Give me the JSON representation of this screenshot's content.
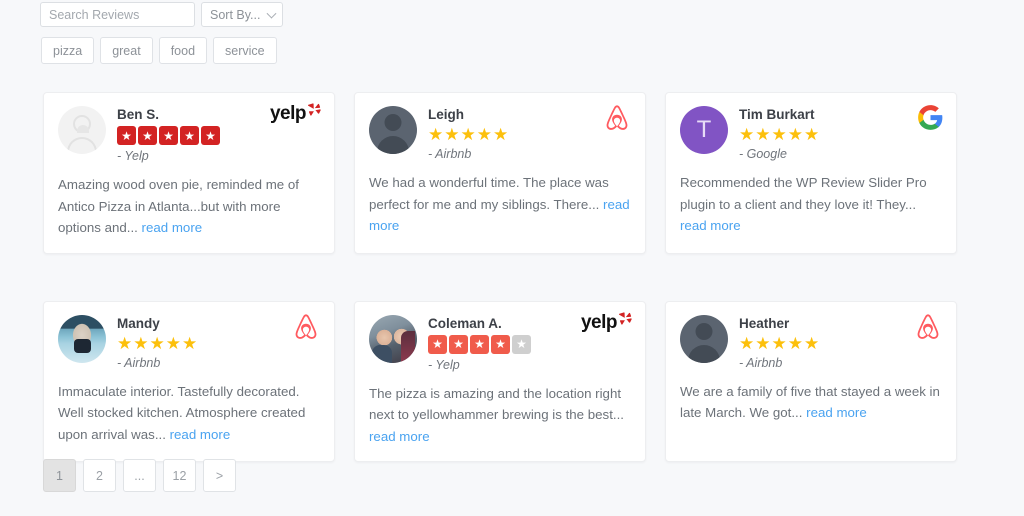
{
  "search": {
    "placeholder": "Search Reviews",
    "value": ""
  },
  "sort": {
    "label": "Sort By...",
    "icon": "chevron-down-icon"
  },
  "keyword_filters": [
    {
      "label": "pizza"
    },
    {
      "label": "great"
    },
    {
      "label": "food"
    },
    {
      "label": "service"
    }
  ],
  "reviews": [
    {
      "name": "Ben S.",
      "source": "- Yelp",
      "platform": "yelp",
      "rating": 5,
      "max_rating": 5,
      "text": "Amazing wood oven pie, reminded me of Antico Pizza in Atlanta...but with more options and...",
      "read_more": "read more",
      "avatar_type": "placeholder-light",
      "avatar_initial": ""
    },
    {
      "name": "Leigh",
      "source": "- Airbnb",
      "platform": "airbnb",
      "rating": 5,
      "max_rating": 5,
      "text": "We had a wonderful time. The place was perfect for me and my siblings. There...",
      "read_more": "read more",
      "avatar_type": "placeholder-dark",
      "avatar_initial": ""
    },
    {
      "name": "Tim Burkart",
      "source": "- Google",
      "platform": "google",
      "rating": 5,
      "max_rating": 5,
      "text": "Recommended the WP Review Slider Pro plugin to a client and they love it! They...",
      "read_more": "read more",
      "avatar_type": "initial",
      "avatar_initial": "T"
    },
    {
      "name": "Mandy",
      "source": "- Airbnb",
      "platform": "airbnb",
      "rating": 5,
      "max_rating": 5,
      "text": "Immaculate interior. Tastefully decorated. Well stocked kitchen. Atmosphere created upon arrival was...",
      "read_more": "read more",
      "avatar_type": "photo-mandy",
      "avatar_initial": ""
    },
    {
      "name": "Coleman A.",
      "source": "- Yelp",
      "platform": "yelp",
      "rating": 4,
      "max_rating": 5,
      "text": "The pizza is amazing and the location right next to yellowhammer brewing is the best...",
      "read_more": "read more",
      "avatar_type": "photo-coleman",
      "avatar_initial": ""
    },
    {
      "name": "Heather",
      "source": "- Airbnb",
      "platform": "airbnb",
      "rating": 5,
      "max_rating": 5,
      "text": "We are a family of five that stayed a week in late March. We got...",
      "read_more": "read more",
      "avatar_type": "placeholder-dark",
      "avatar_initial": ""
    }
  ],
  "pagination": {
    "items": [
      {
        "label": "1",
        "active": true
      },
      {
        "label": "2",
        "active": false
      },
      {
        "label": "...",
        "active": false
      },
      {
        "label": "12",
        "active": false
      },
      {
        "label": ">",
        "active": false
      }
    ]
  },
  "logos": {
    "yelp_text": "yelp",
    "airbnb_name": "airbnb-logo",
    "google_name": "google-logo"
  },
  "colors": {
    "page_bg": "#f7f8fa",
    "card_bg": "#ffffff",
    "link": "#4aa3f0",
    "star_gold": "#fcc00c",
    "star_empty": "#dcdcdc",
    "yelp_red_full": "#d32323",
    "yelp_red_partial": "#f05b4b",
    "airbnb_red": "#ff5a5f",
    "google_blue": "#4285f4",
    "avatar_purple": "#8154c4"
  }
}
